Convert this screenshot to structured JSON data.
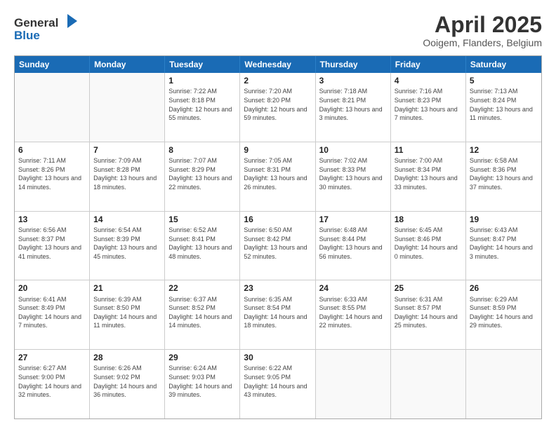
{
  "logo": {
    "line1": "General",
    "line2": "Blue"
  },
  "header": {
    "month": "April 2025",
    "location": "Ooigem, Flanders, Belgium"
  },
  "weekdays": [
    "Sunday",
    "Monday",
    "Tuesday",
    "Wednesday",
    "Thursday",
    "Friday",
    "Saturday"
  ],
  "weeks": [
    [
      {
        "day": "",
        "info": ""
      },
      {
        "day": "",
        "info": ""
      },
      {
        "day": "1",
        "info": "Sunrise: 7:22 AM\nSunset: 8:18 PM\nDaylight: 12 hours and 55 minutes."
      },
      {
        "day": "2",
        "info": "Sunrise: 7:20 AM\nSunset: 8:20 PM\nDaylight: 12 hours and 59 minutes."
      },
      {
        "day": "3",
        "info": "Sunrise: 7:18 AM\nSunset: 8:21 PM\nDaylight: 13 hours and 3 minutes."
      },
      {
        "day": "4",
        "info": "Sunrise: 7:16 AM\nSunset: 8:23 PM\nDaylight: 13 hours and 7 minutes."
      },
      {
        "day": "5",
        "info": "Sunrise: 7:13 AM\nSunset: 8:24 PM\nDaylight: 13 hours and 11 minutes."
      }
    ],
    [
      {
        "day": "6",
        "info": "Sunrise: 7:11 AM\nSunset: 8:26 PM\nDaylight: 13 hours and 14 minutes."
      },
      {
        "day": "7",
        "info": "Sunrise: 7:09 AM\nSunset: 8:28 PM\nDaylight: 13 hours and 18 minutes."
      },
      {
        "day": "8",
        "info": "Sunrise: 7:07 AM\nSunset: 8:29 PM\nDaylight: 13 hours and 22 minutes."
      },
      {
        "day": "9",
        "info": "Sunrise: 7:05 AM\nSunset: 8:31 PM\nDaylight: 13 hours and 26 minutes."
      },
      {
        "day": "10",
        "info": "Sunrise: 7:02 AM\nSunset: 8:33 PM\nDaylight: 13 hours and 30 minutes."
      },
      {
        "day": "11",
        "info": "Sunrise: 7:00 AM\nSunset: 8:34 PM\nDaylight: 13 hours and 33 minutes."
      },
      {
        "day": "12",
        "info": "Sunrise: 6:58 AM\nSunset: 8:36 PM\nDaylight: 13 hours and 37 minutes."
      }
    ],
    [
      {
        "day": "13",
        "info": "Sunrise: 6:56 AM\nSunset: 8:37 PM\nDaylight: 13 hours and 41 minutes."
      },
      {
        "day": "14",
        "info": "Sunrise: 6:54 AM\nSunset: 8:39 PM\nDaylight: 13 hours and 45 minutes."
      },
      {
        "day": "15",
        "info": "Sunrise: 6:52 AM\nSunset: 8:41 PM\nDaylight: 13 hours and 48 minutes."
      },
      {
        "day": "16",
        "info": "Sunrise: 6:50 AM\nSunset: 8:42 PM\nDaylight: 13 hours and 52 minutes."
      },
      {
        "day": "17",
        "info": "Sunrise: 6:48 AM\nSunset: 8:44 PM\nDaylight: 13 hours and 56 minutes."
      },
      {
        "day": "18",
        "info": "Sunrise: 6:45 AM\nSunset: 8:46 PM\nDaylight: 14 hours and 0 minutes."
      },
      {
        "day": "19",
        "info": "Sunrise: 6:43 AM\nSunset: 8:47 PM\nDaylight: 14 hours and 3 minutes."
      }
    ],
    [
      {
        "day": "20",
        "info": "Sunrise: 6:41 AM\nSunset: 8:49 PM\nDaylight: 14 hours and 7 minutes."
      },
      {
        "day": "21",
        "info": "Sunrise: 6:39 AM\nSunset: 8:50 PM\nDaylight: 14 hours and 11 minutes."
      },
      {
        "day": "22",
        "info": "Sunrise: 6:37 AM\nSunset: 8:52 PM\nDaylight: 14 hours and 14 minutes."
      },
      {
        "day": "23",
        "info": "Sunrise: 6:35 AM\nSunset: 8:54 PM\nDaylight: 14 hours and 18 minutes."
      },
      {
        "day": "24",
        "info": "Sunrise: 6:33 AM\nSunset: 8:55 PM\nDaylight: 14 hours and 22 minutes."
      },
      {
        "day": "25",
        "info": "Sunrise: 6:31 AM\nSunset: 8:57 PM\nDaylight: 14 hours and 25 minutes."
      },
      {
        "day": "26",
        "info": "Sunrise: 6:29 AM\nSunset: 8:59 PM\nDaylight: 14 hours and 29 minutes."
      }
    ],
    [
      {
        "day": "27",
        "info": "Sunrise: 6:27 AM\nSunset: 9:00 PM\nDaylight: 14 hours and 32 minutes."
      },
      {
        "day": "28",
        "info": "Sunrise: 6:26 AM\nSunset: 9:02 PM\nDaylight: 14 hours and 36 minutes."
      },
      {
        "day": "29",
        "info": "Sunrise: 6:24 AM\nSunset: 9:03 PM\nDaylight: 14 hours and 39 minutes."
      },
      {
        "day": "30",
        "info": "Sunrise: 6:22 AM\nSunset: 9:05 PM\nDaylight: 14 hours and 43 minutes."
      },
      {
        "day": "",
        "info": ""
      },
      {
        "day": "",
        "info": ""
      },
      {
        "day": "",
        "info": ""
      }
    ]
  ]
}
